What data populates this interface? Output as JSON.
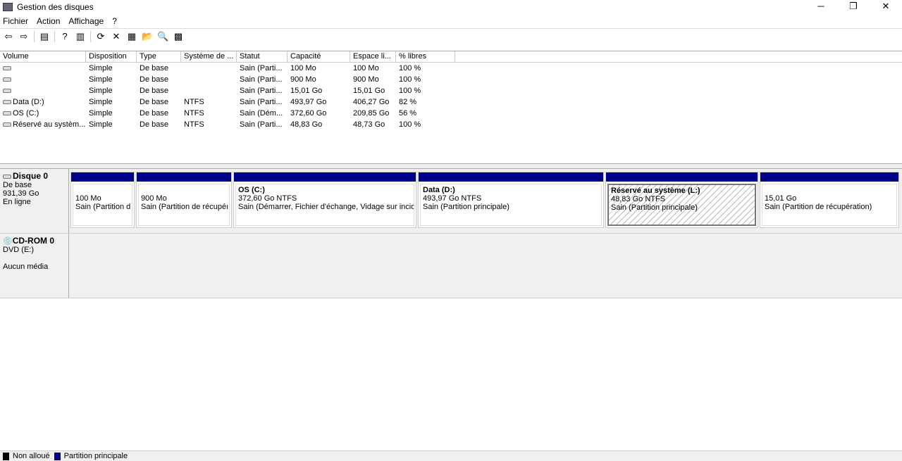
{
  "window": {
    "title": "Gestion des disques",
    "min": "─",
    "restore": "❐",
    "close": "✕"
  },
  "menu": [
    "Fichier",
    "Action",
    "Affichage",
    "?"
  ],
  "toolbar": [
    {
      "name": "back-icon",
      "g": "⇦"
    },
    {
      "name": "forward-icon",
      "g": "⇨"
    },
    {
      "name": "console-tree-icon",
      "g": "▤"
    },
    {
      "name": "help-icon",
      "g": "?"
    },
    {
      "name": "action-pane-icon",
      "g": "▥"
    },
    {
      "name": "refresh-icon",
      "g": "⟳"
    },
    {
      "name": "delete-icon",
      "g": "✕"
    },
    {
      "name": "properties-icon",
      "g": "▦"
    },
    {
      "name": "open-icon",
      "g": "📂"
    },
    {
      "name": "search-icon",
      "g": "🔍"
    },
    {
      "name": "settings-icon",
      "g": "▩"
    }
  ],
  "columns": [
    "Volume",
    "Disposition",
    "Type",
    "Système de ...",
    "Statut",
    "Capacité",
    "Espace li...",
    "% libres"
  ],
  "rows": [
    [
      "",
      "Simple",
      "De base",
      "",
      "Sain (Parti...",
      "100 Mo",
      "100 Mo",
      "100 %"
    ],
    [
      "",
      "Simple",
      "De base",
      "",
      "Sain (Parti...",
      "900 Mo",
      "900 Mo",
      "100 %"
    ],
    [
      "",
      "Simple",
      "De base",
      "",
      "Sain (Parti...",
      "15,01 Go",
      "15,01 Go",
      "100 %"
    ],
    [
      "Data (D:)",
      "Simple",
      "De base",
      "NTFS",
      "Sain (Parti...",
      "493,97 Go",
      "406,27 Go",
      "82 %"
    ],
    [
      "OS (C:)",
      "Simple",
      "De base",
      "NTFS",
      "Sain (Dém...",
      "372,60 Go",
      "209,85 Go",
      "56 %"
    ],
    [
      "Réservé au systèm...",
      "Simple",
      "De base",
      "NTFS",
      "Sain (Parti...",
      "48,83 Go",
      "48,73 Go",
      "100 %"
    ]
  ],
  "disk0": {
    "name": "Disque 0",
    "type": "De base",
    "size": "931,39 Go",
    "state": "En ligne",
    "partitions": [
      {
        "title": "",
        "size": "100 Mo",
        "status": "Sain (Partition d"
      },
      {
        "title": "",
        "size": "900 Mo",
        "status": "Sain (Partition de récupéı"
      },
      {
        "title": "OS  (C:)",
        "size": "372,60 Go NTFS",
        "status": "Sain (Démarrer, Fichier d'échange, Vidage sur incid"
      },
      {
        "title": "Data  (D:)",
        "size": "493,97 Go NTFS",
        "status": "Sain (Partition principale)"
      },
      {
        "title": "Réservé au système  (L:)",
        "size": "48,83 Go NTFS",
        "status": "Sain (Partition principale)"
      },
      {
        "title": "",
        "size": "15,01 Go",
        "status": "Sain (Partition de récupération)"
      }
    ]
  },
  "cdrom0": {
    "name": "CD-ROM 0",
    "drive": "DVD (E:)",
    "media": "Aucun média"
  },
  "legend": [
    {
      "label": "Non alloué",
      "color": "#000000"
    },
    {
      "label": "Partition principale",
      "color": "#00008b"
    }
  ]
}
